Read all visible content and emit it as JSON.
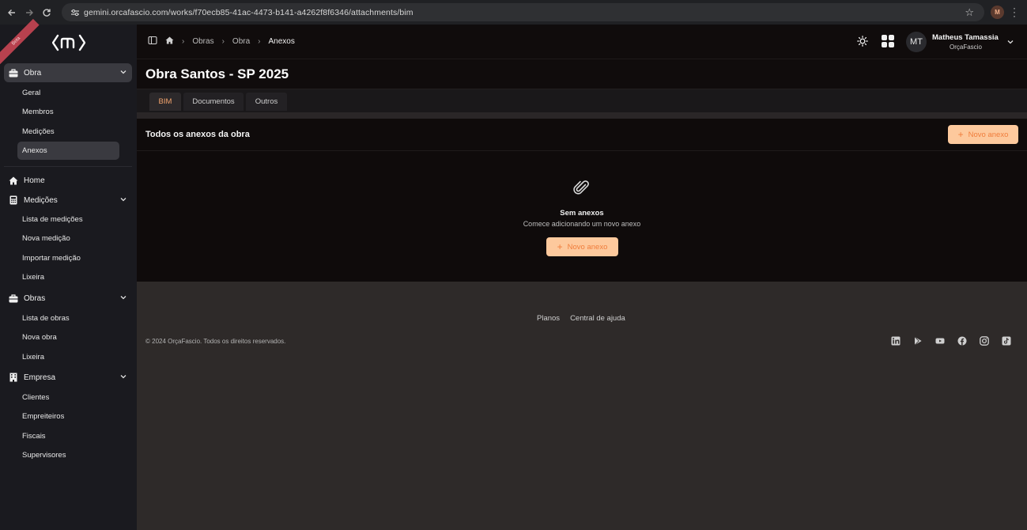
{
  "browser": {
    "url": "gemini.orcafascio.com/works/f70ecb85-41ac-4473-b141-a4262f8f6346/attachments/bim",
    "profile_initial": "M"
  },
  "sidebar": {
    "beta_label": "Beta",
    "obra_group": {
      "label": "Obra",
      "items": [
        "Geral",
        "Membros",
        "Medições",
        "Anexos"
      ],
      "selected": "Anexos"
    },
    "home_label": "Home",
    "medicoes_group": {
      "label": "Medições",
      "items": [
        "Lista de medições",
        "Nova medição",
        "Importar medição",
        "Lixeira"
      ]
    },
    "obras_group": {
      "label": "Obras",
      "items": [
        "Lista de obras",
        "Nova obra",
        "Lixeira"
      ]
    },
    "empresa_group": {
      "label": "Empresa",
      "items": [
        "Clientes",
        "Empreiteiros",
        "Fiscais",
        "Supervisores"
      ]
    }
  },
  "topbar": {
    "breadcrumbs": [
      "Obras",
      "Obra",
      "Anexos"
    ],
    "avatar_initials": "MT",
    "user_name": "Matheus Tamassia",
    "user_org": "OrçaFascio"
  },
  "page": {
    "title": "Obra Santos - SP 2025",
    "tabs": [
      "BIM",
      "Documentos",
      "Outros"
    ],
    "active_tab": "BIM"
  },
  "card": {
    "title": "Todos os anexos da obra",
    "new_button": "Novo anexo",
    "empty_title": "Sem anexos",
    "empty_subtitle": "Comece adicionando um novo anexo"
  },
  "footer": {
    "links": [
      "Planos",
      "Central de ajuda"
    ],
    "copyright": "© 2024 OrçaFascio. Todos os direitos reservados.",
    "socials": [
      "linkedin-icon",
      "play-store-icon",
      "youtube-icon",
      "facebook-icon",
      "instagram-icon",
      "tiktok-icon"
    ]
  },
  "colors": {
    "accent_bg": "#fdc99d",
    "accent_text": "#f07d3c",
    "sidebar_bg": "#1a1a1f",
    "content_bg": "#0f0b0b",
    "page_bg": "#2e2a29"
  }
}
